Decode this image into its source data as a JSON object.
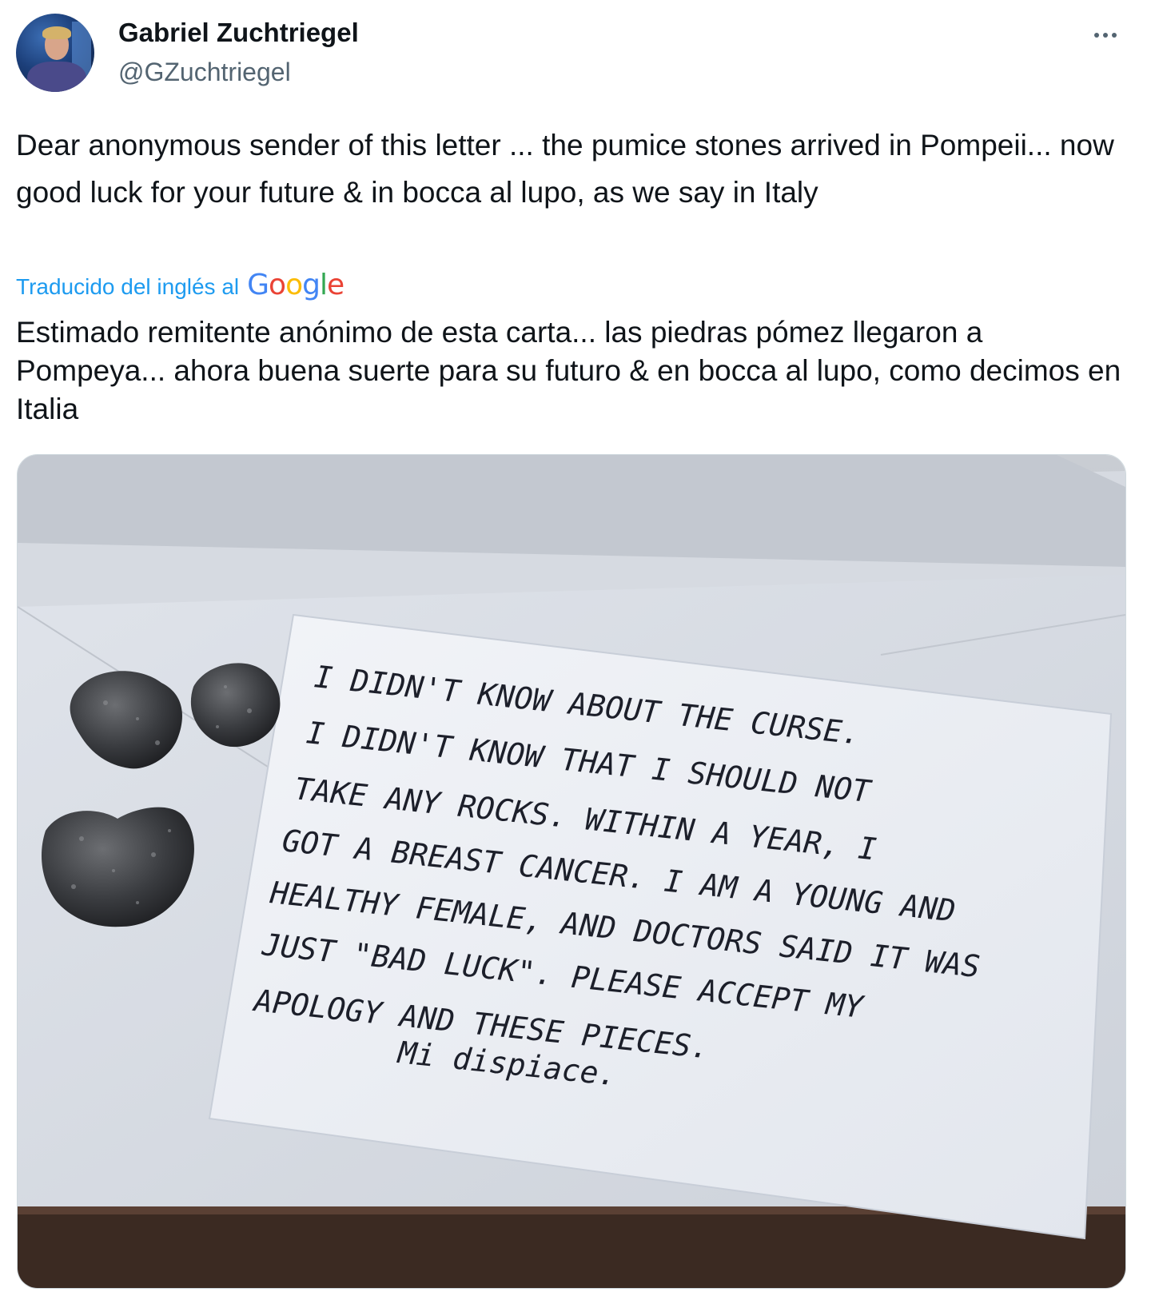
{
  "tweet": {
    "author": {
      "display_name": "Gabriel Zuchtriegel",
      "handle": "@GZuchtriegel"
    },
    "text": "Dear anonymous sender of this letter ... the pumice stones arrived in Pompeii... now good luck for your future & in bocca al lupo, as we say in Italy",
    "translation": {
      "label": "Traducido del inglés al",
      "provider": "Google",
      "text": "Estimado remitente anónimo de esta carta... las piedras pómez llegaron a Pompeya... ahora buena suerte para su futuro & en bocca al lupo, como decimos en Italia"
    },
    "icons": {
      "more": "more-horizontal-icon"
    },
    "colors": {
      "link": "#1d9bf0",
      "secondary_text": "#536471",
      "primary_text": "#0f1419"
    }
  },
  "media": {
    "letter_lines": [
      "I DIDN'T KNOW ABOUT THE CURSE.",
      "I DIDN'T KNOW THAT I SHOULD NOT",
      "TAKE ANY ROCKS. WITHIN A YEAR, I",
      "GOT A BREAST CANCER. I AM A YOUNG AND",
      "HEALTHY FEMALE, AND DOCTORS SAID IT WAS",
      "JUST \"BAD LUCK\". PLEASE ACCEPT MY",
      "APOLOGY AND THESE PIECES.",
      "Mi dispiace."
    ]
  }
}
